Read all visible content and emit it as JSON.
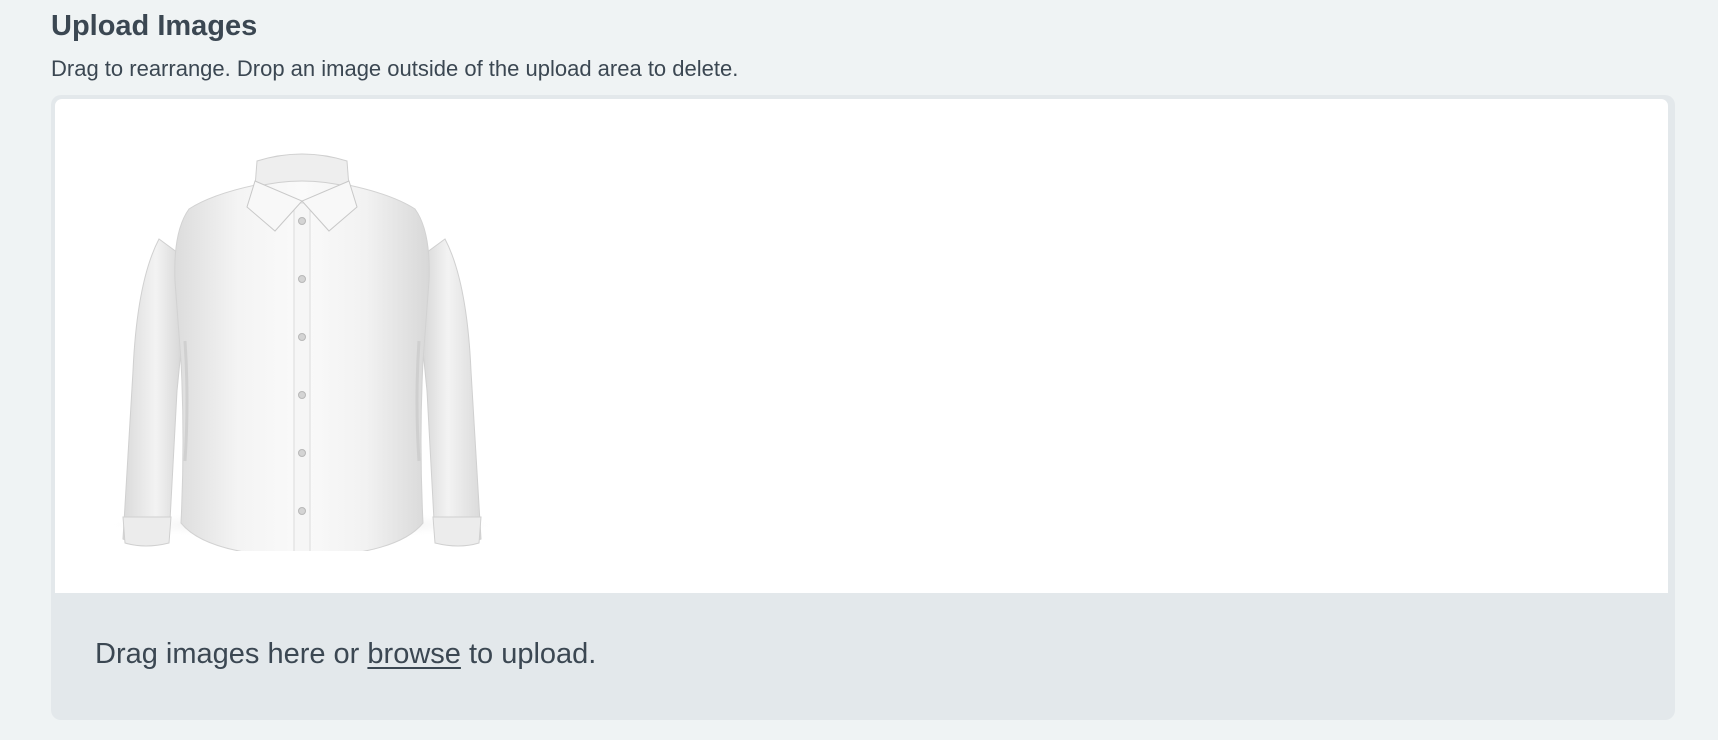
{
  "section": {
    "title": "Upload Images",
    "subtitle": "Drag to rearrange. Drop an image outside of the upload area to delete."
  },
  "dropzone": {
    "prefix": "Drag images here or ",
    "link": "browse",
    "suffix": " to upload."
  },
  "images": [
    {
      "subject": "white-dress-shirt"
    }
  ],
  "colors": {
    "page_bg": "#eff3f4",
    "dropzone_bg": "#e3e8eb",
    "preview_bg": "#ffffff",
    "text": "#3b4752"
  }
}
